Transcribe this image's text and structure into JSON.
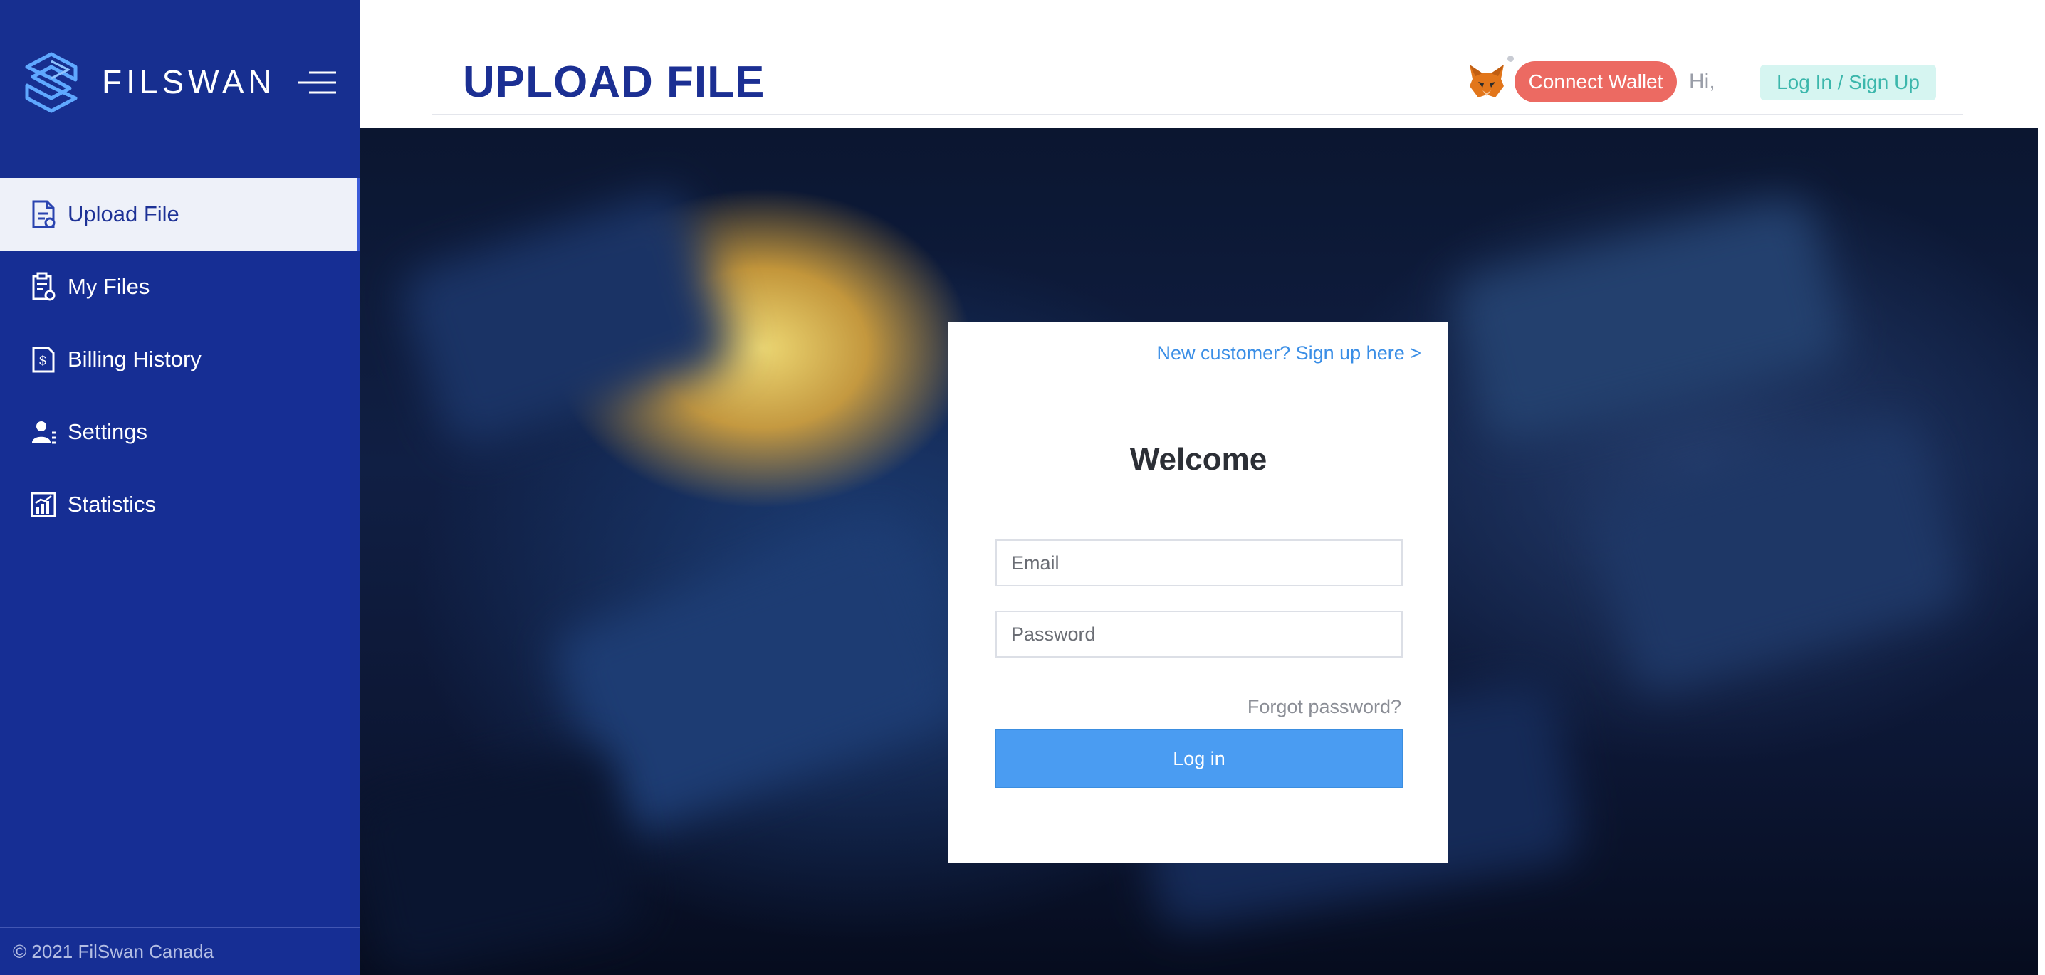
{
  "brand": {
    "name": "FILSWAN"
  },
  "sidebar": {
    "items": [
      {
        "label": "Upload File",
        "icon": "upload-file-icon",
        "active": true
      },
      {
        "label": "My Files",
        "icon": "my-files-icon",
        "active": false
      },
      {
        "label": "Billing History",
        "icon": "billing-icon",
        "active": false
      },
      {
        "label": "Settings",
        "icon": "settings-icon",
        "active": false
      },
      {
        "label": "Statistics",
        "icon": "statistics-icon",
        "active": false
      }
    ],
    "footer": "© 2021 FilSwan Canada"
  },
  "header": {
    "title": "UPLOAD FILE",
    "connect_wallet": "Connect Wallet",
    "greeting": "Hi,",
    "login_signup": "Log In / Sign Up"
  },
  "login_card": {
    "signup_link": "New customer? Sign up here >",
    "title": "Welcome",
    "email_placeholder": "Email",
    "password_placeholder": "Password",
    "forgot": "Forgot password?",
    "submit": "Log in"
  },
  "colors": {
    "sidebar_bg": "#162e94",
    "title": "#1b2f93",
    "wallet_button": "#ec6a62",
    "login_signup_bg": "#d6f5f1",
    "login_signup_text": "#3cb7ac",
    "primary_button": "#4a9cf2",
    "link": "#3a8ee6"
  }
}
